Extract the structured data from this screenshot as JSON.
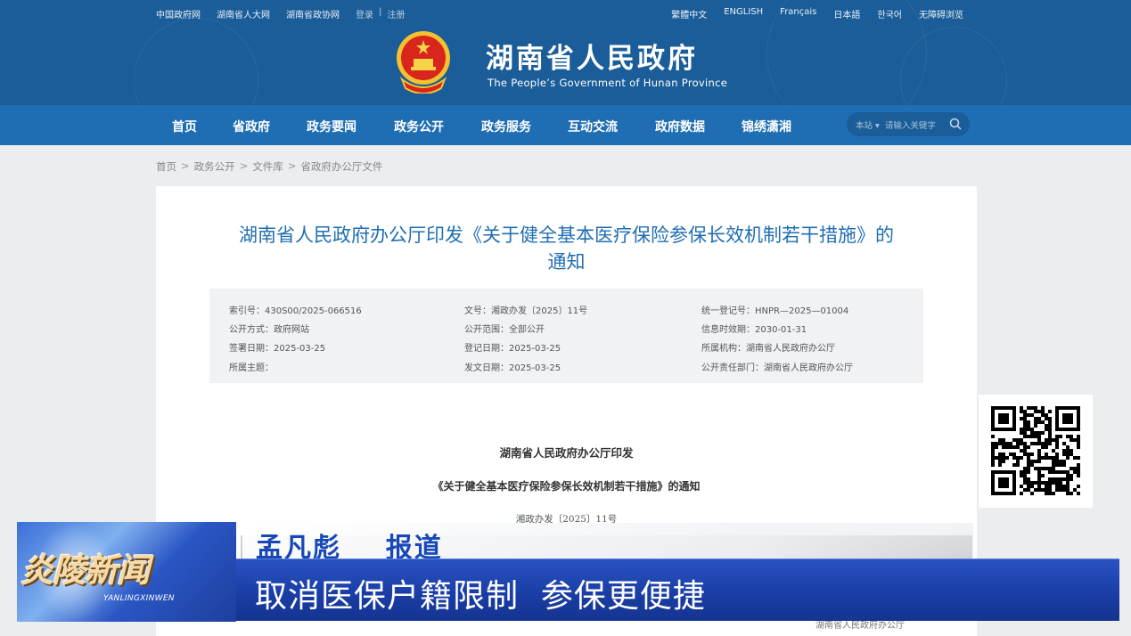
{
  "top_links_left": [
    "中国政府网",
    "湖南省人大网",
    "湖南省政协网",
    "登录",
    "|",
    "注册"
  ],
  "top_links_right": [
    "繁體中文",
    "ENGLISH",
    "Français",
    "日本語",
    "한국어",
    "无障碍浏览"
  ],
  "site": {
    "title": "湖南省人民政府",
    "subtitle": "The People’s Government of Hunan Province"
  },
  "nav": [
    "首页",
    "省政府",
    "政务要闻",
    "政务公开",
    "政务服务",
    "互动交流",
    "政府数据",
    "锦绣潇湘"
  ],
  "search": {
    "scope": "本站",
    "placeholder": "请输入关键字"
  },
  "breadcrumb": [
    "首页",
    "政务公开",
    "文件库",
    "省政府办公厅文件"
  ],
  "document": {
    "title_line1": "湖南省人民政府办公厅印发《关于健全基本医疗保险参保长效机制若干措施》的",
    "title_line2": "通知",
    "meta": [
      [
        "索引号：430S00/2025-066516",
        "文号：湘政办发〔2025〕11号",
        "统一登记号：HNPR—2025—01004"
      ],
      [
        "公开方式：政府网站",
        "公开范围：全部公开",
        "信息时效期：2030-01-31"
      ],
      [
        "签署日期：2025-03-25",
        "登记日期：2025-03-25",
        "所属机构：湖南省人民政府办公厅"
      ],
      [
        "所属主题：",
        "发文日期：2025-03-25",
        "公开责任部门：湖南省人民政府办公厅"
      ]
    ],
    "issuer": "湖南省人民政府办公厅印发",
    "notice_title": "《关于健全基本医疗保险参保长效机制若干措施》的通知",
    "doc_number": "湘政办发〔2025〕11号",
    "signature": "湖南省人民政府办公厅"
  },
  "overlay": {
    "logo_cn": "炎陵新闻",
    "logo_en": "YANLINGXINWEN",
    "reporter": "孟凡彪    报道",
    "headline": "取消医保户籍限制  参保更便捷"
  },
  "colors": {
    "header_bg": "#1a5d98",
    "nav_bg": "#1f6eb3",
    "title_blue": "#1f6eb3",
    "ticker_blue": "#1a3ea6",
    "reporter_blue": "#1848b8"
  }
}
